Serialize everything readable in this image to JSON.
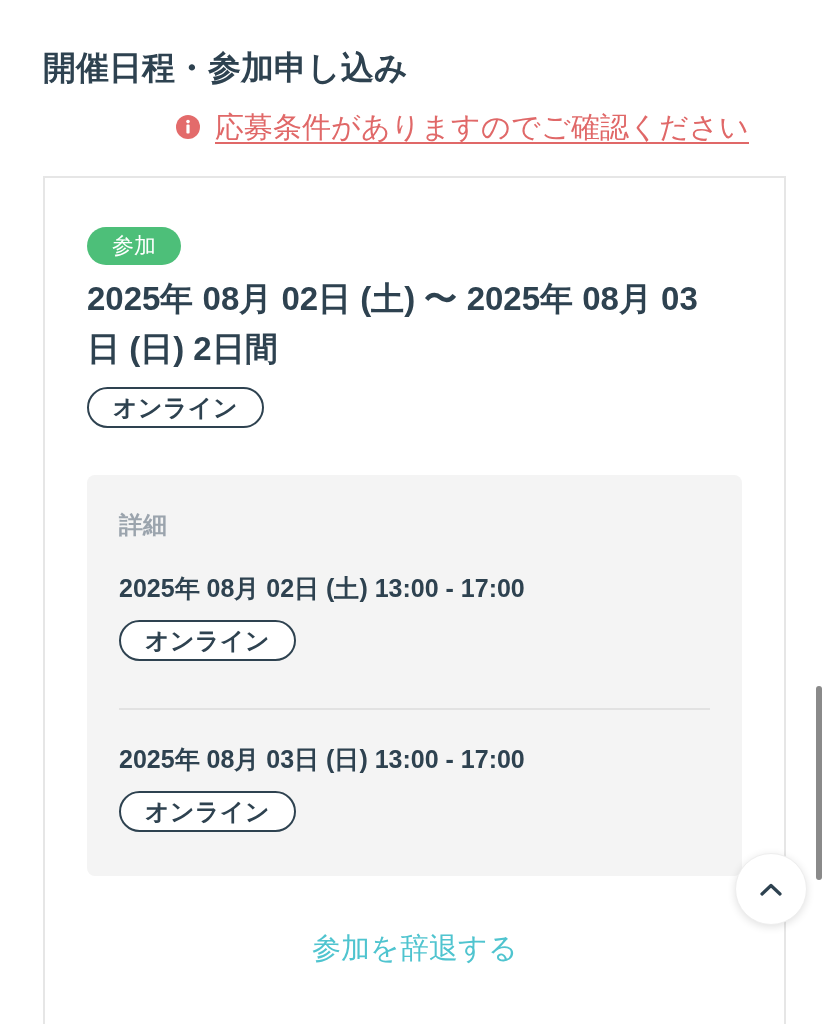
{
  "section": {
    "title": "開催日程・参加申し込み",
    "notice": "応募条件がありますのでご確認ください"
  },
  "event": {
    "status_badge": "参加",
    "date_range": "2025年 08月 02日 (土) 〜 2025年 08月 03日 (日) 2日間",
    "format_tag": "オンライン",
    "details": {
      "heading": "詳細",
      "sessions": [
        {
          "datetime": "2025年 08月 02日 (土) 13:00 - 17:00",
          "format_tag": "オンライン"
        },
        {
          "datetime": "2025年 08月 03日 (日) 13:00 - 17:00",
          "format_tag": "オンライン"
        }
      ]
    },
    "cancel_link": "参加を辞退する"
  }
}
